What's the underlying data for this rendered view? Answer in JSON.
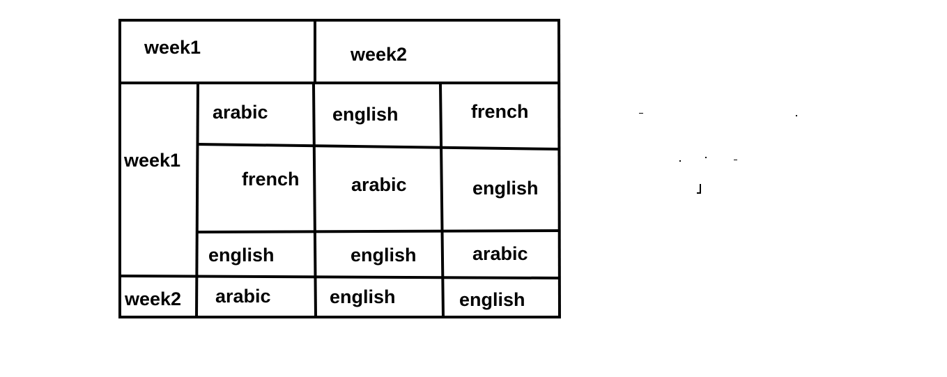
{
  "header": {
    "week1": "week1",
    "week2": "week2"
  },
  "rows": {
    "week1": "week1",
    "week2": "week2"
  },
  "cells": {
    "r1c1": "arabic",
    "r1c2": "english",
    "r1c3": "french",
    "r2c1": "french",
    "r2c2": "arabic",
    "r2c3": "english",
    "r3c1": "english",
    "r3c2": "english",
    "r3c3": "arabic",
    "r4c1": "arabic",
    "r4c2": "english",
    "r4c3": "english"
  },
  "colors": {
    "line": "#000000",
    "background": "#ffffff",
    "text": "#000000"
  }
}
